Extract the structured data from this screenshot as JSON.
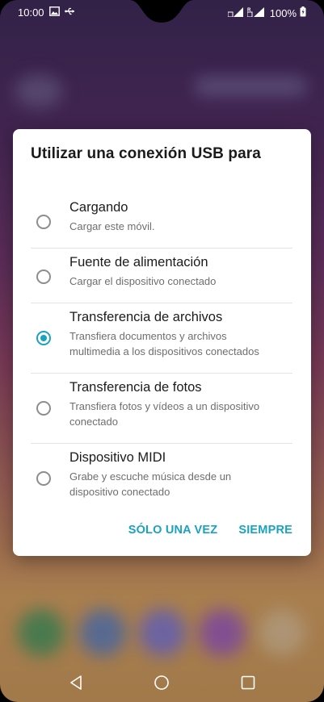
{
  "status_bar": {
    "time": "10:00",
    "left_icons": [
      "image-icon",
      "usb-icon"
    ],
    "battery_percent": "100%",
    "right_icons": [
      "signal-icon",
      "roaming-signal-icon",
      "battery-charging-icon"
    ]
  },
  "dialog": {
    "title": "Utilizar una conexión USB para",
    "options": [
      {
        "title": "Cargando",
        "subtitle_lines": [
          "Cargar este móvil."
        ],
        "selected": false
      },
      {
        "title": "Fuente de alimentación",
        "subtitle_lines": [
          "Cargar el dispositivo conectado"
        ],
        "selected": false
      },
      {
        "title": "Transferencia de archivos",
        "subtitle_lines": [
          "Transfiera documentos y archivos",
          "multimedia a los dispositivos conectados"
        ],
        "selected": true
      },
      {
        "title": "Transferencia de fotos",
        "subtitle_lines": [
          "Transfiera fotos y vídeos a un dispositivo",
          "conectado"
        ],
        "selected": false
      },
      {
        "title": "Dispositivo MIDI",
        "subtitle_lines": [
          "Grabe y escuche música desde un",
          "dispositivo conectado"
        ],
        "selected": false
      }
    ],
    "buttons": {
      "once": "SÓLO UNA VEZ",
      "always": "SIEMPRE"
    }
  },
  "nav_bar": {
    "buttons": [
      "back-icon",
      "home-icon",
      "recents-icon"
    ]
  },
  "colors": {
    "accent": "#1aa2c1",
    "radio_unselected": "#8d8d8d",
    "divider": "#e3e3e3"
  }
}
